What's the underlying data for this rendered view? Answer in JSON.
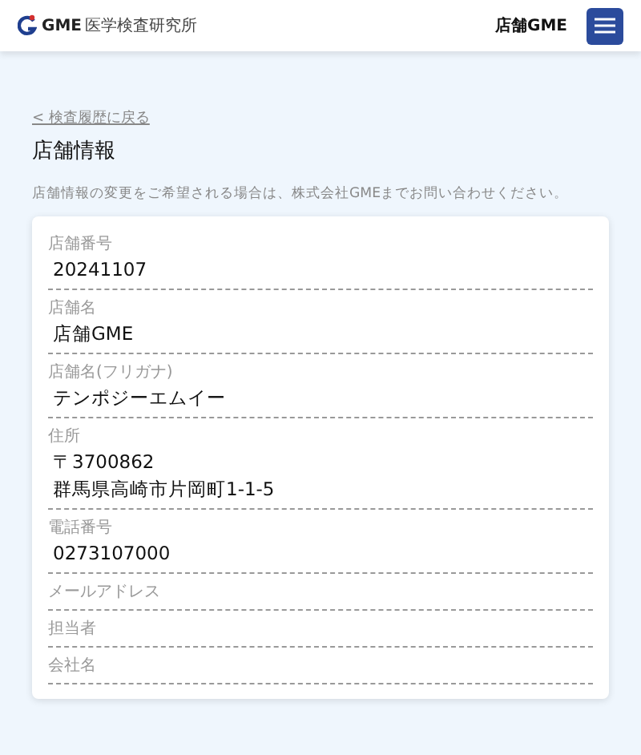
{
  "header": {
    "logo_brand": "GME",
    "logo_name": "医学検査研究所",
    "store": "店舗GME"
  },
  "back_link": "< 検査履歴に戻る",
  "title": "店舗情報",
  "notice": "店舗情報の変更をご希望される場合は、株式会社GMEまでお問い合わせください。",
  "fields": [
    {
      "label": "店舗番号",
      "value": [
        "20241107"
      ]
    },
    {
      "label": "店舗名",
      "value": [
        "店舗GME"
      ]
    },
    {
      "label": "店舗名(フリガナ)",
      "value": [
        "テンポジーエムイー"
      ]
    },
    {
      "label": "住所",
      "value": [
        "〒3700862",
        "群馬県高崎市片岡町1-1-5"
      ]
    },
    {
      "label": "電話番号",
      "value": [
        "0273107000"
      ]
    },
    {
      "label": "メールアドレス"
    },
    {
      "label": "担当者"
    },
    {
      "label": "会社名"
    }
  ]
}
